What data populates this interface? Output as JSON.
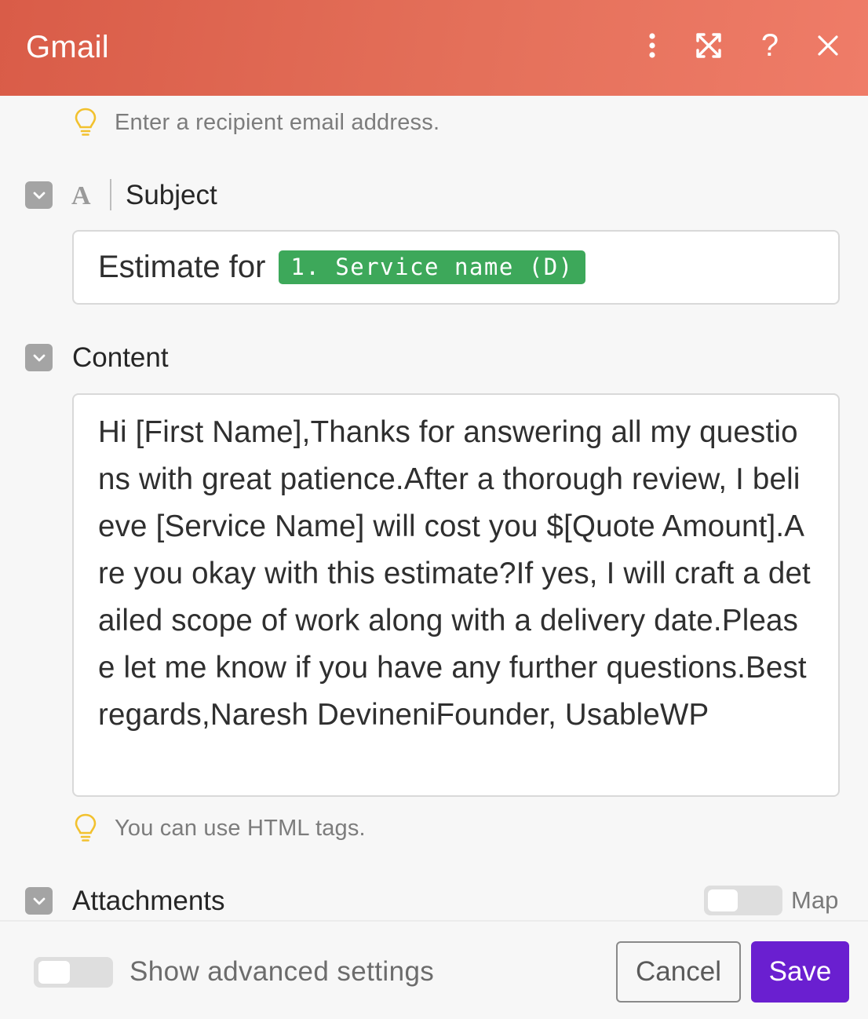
{
  "header": {
    "title": "Gmail",
    "icons": [
      "more-vertical-icon",
      "expand-icon",
      "help-icon",
      "close-icon"
    ],
    "help_glyph": "?"
  },
  "to_hint": "Enter a recipient email address.",
  "subject": {
    "label": "Subject",
    "type_glyph": "A",
    "prefix": "Estimate for",
    "pill": "1. Service name (D)"
  },
  "content": {
    "label": "Content",
    "text": "Hi [First Name],Thanks for answering all my questions with great patience.After a thorough review, I believe [Service Name] will cost you $[Quote Amount].Are you okay with this estimate?If yes, I will craft a detailed scope of work along with a delivery date.Please let me know if you have any further questions.Best regards,Naresh DevineniFounder, UsableWP",
    "hint": "You can use HTML tags."
  },
  "attachments": {
    "label": "Attachments",
    "map_label": "Map",
    "map_on": false
  },
  "footer": {
    "advanced_label": "Show advanced settings",
    "advanced_on": false,
    "cancel": "Cancel",
    "save": "Save"
  },
  "colors": {
    "header_start": "#d95c48",
    "header_end": "#ef7c68",
    "pill": "#3da85a",
    "save": "#6a1fd0",
    "hint_icon": "#f2c12e"
  }
}
